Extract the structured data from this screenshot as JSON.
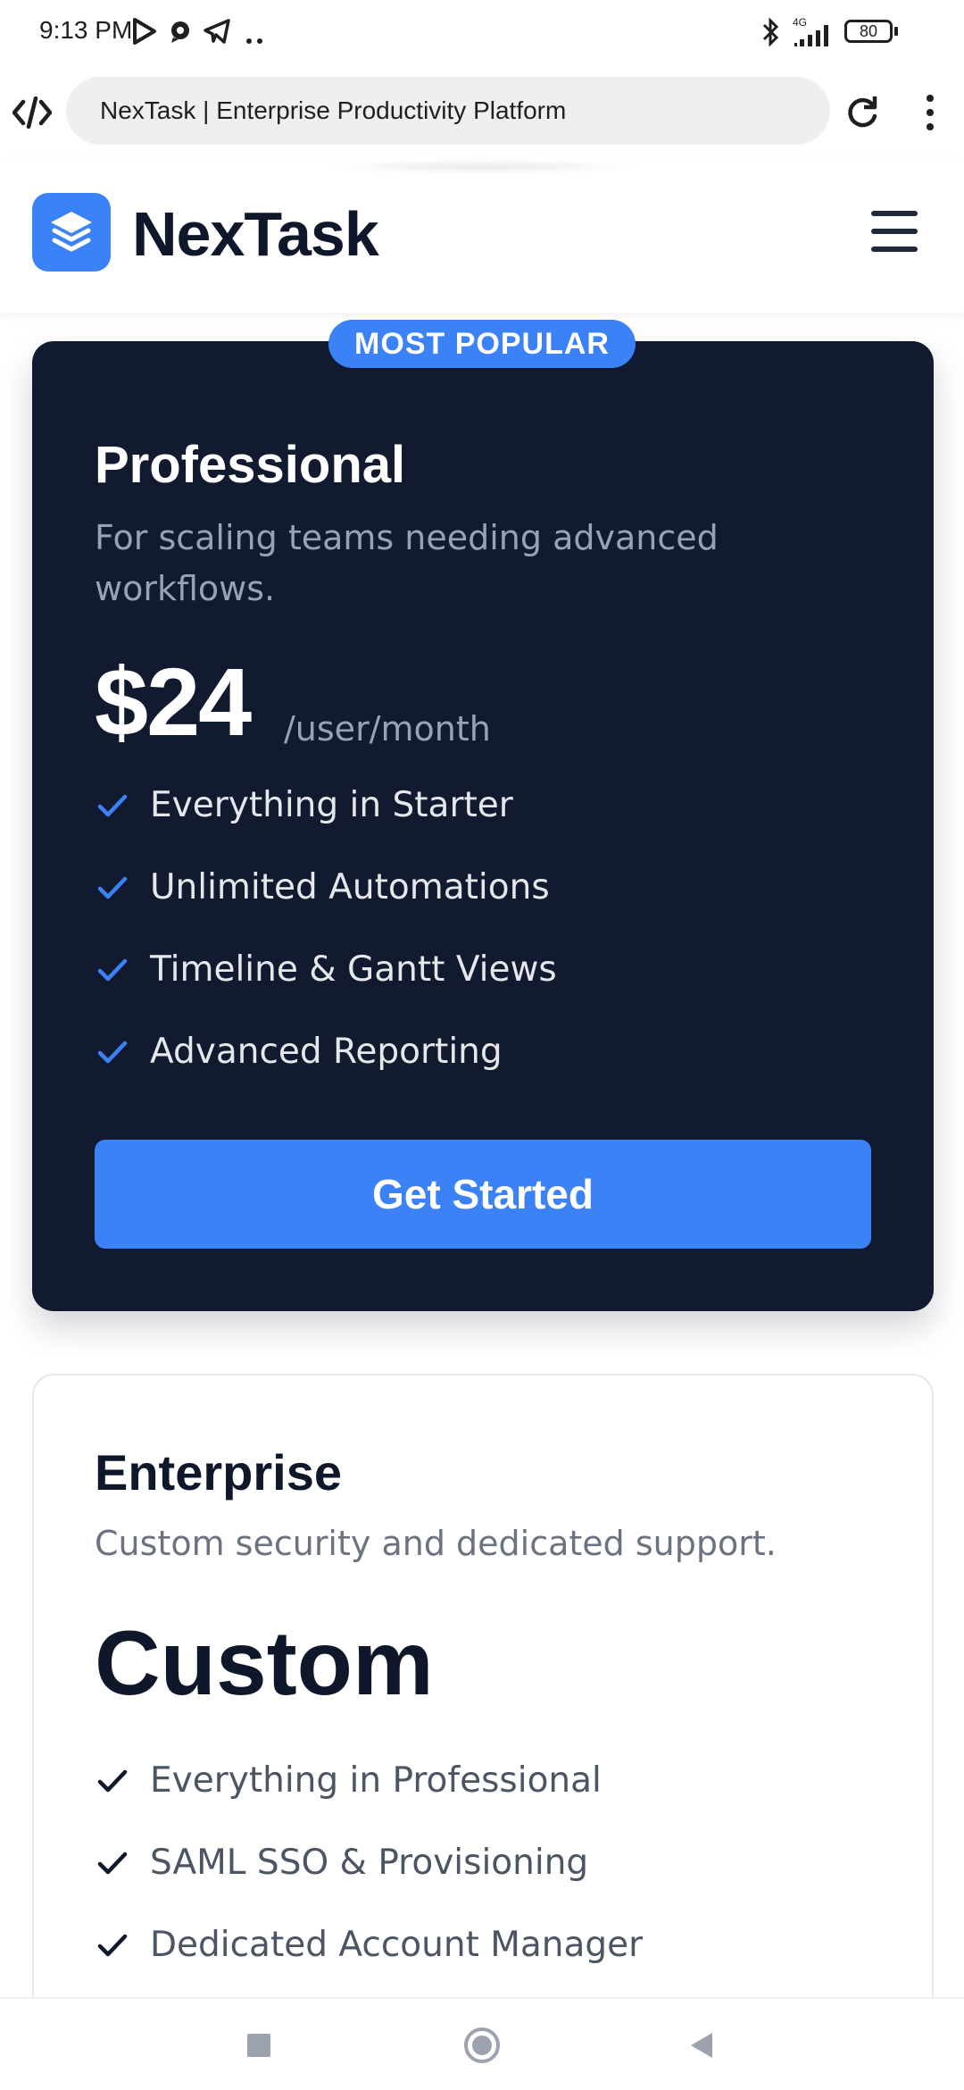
{
  "status_bar": {
    "time": "9:13 PM",
    "network_label": "4G",
    "battery": "80",
    "icons": [
      "play-store-icon",
      "chat-bubble-icon",
      "telegram-icon",
      "more-notifications-icon",
      "bluetooth-icon",
      "signal-icon",
      "battery-icon"
    ]
  },
  "browser": {
    "url_text": "NexTask | Enterprise Productivity Platform",
    "icons": [
      "site-settings-icon",
      "reload-icon",
      "more-vert-icon"
    ]
  },
  "header": {
    "brand": "NexTask",
    "logo_icon": "stacked-layers-icon",
    "menu_icon": "hamburger-menu-icon"
  },
  "colors": {
    "accent": "#3b82f6",
    "dark_card": "#111a2e",
    "heading": "#0f172a",
    "muted": "#94a3b8"
  },
  "pricing": {
    "professional": {
      "badge": "MOST POPULAR",
      "title": "Professional",
      "subtitle": "For scaling teams needing advanced workflows.",
      "price": "$24",
      "period": "/user/month",
      "features": [
        "Everything in Starter",
        "Unlimited Automations",
        "Timeline & Gantt Views",
        "Advanced Reporting"
      ],
      "cta": "Get Started"
    },
    "enterprise": {
      "title": "Enterprise",
      "subtitle": "Custom security and dedicated support.",
      "price": "Custom",
      "features": [
        "Everything in Professional",
        "SAML SSO & Provisioning",
        "Dedicated Account Manager"
      ]
    }
  },
  "nav_bar": {
    "icons": [
      "recents-square-icon",
      "home-circle-icon",
      "back-triangle-icon"
    ]
  }
}
